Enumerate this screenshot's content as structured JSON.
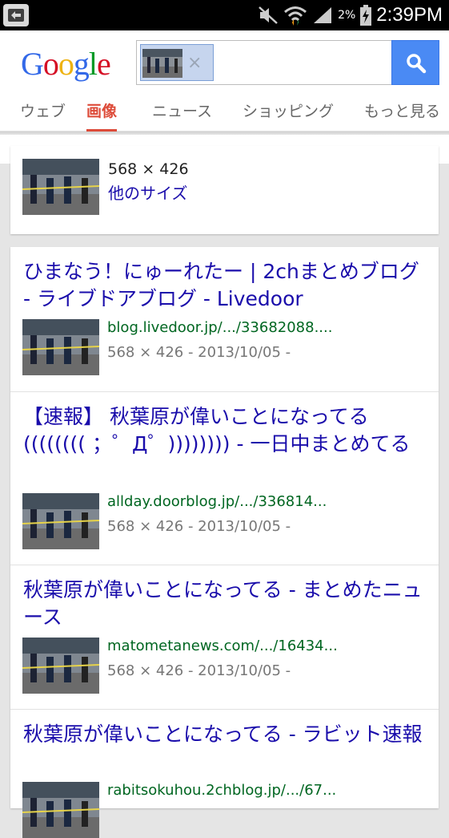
{
  "status_bar": {
    "battery_percent": "2%",
    "time": "2:39PM"
  },
  "header": {
    "logo_letters": [
      "G",
      "o",
      "o",
      "g",
      "l",
      "e"
    ],
    "search_chip_remove": "×"
  },
  "tabs": [
    {
      "label": "ウェブ",
      "active": false
    },
    {
      "label": "画像",
      "active": true
    },
    {
      "label": "ニュース",
      "active": false
    },
    {
      "label": "ショッピング",
      "active": false
    },
    {
      "label": "もっと見る",
      "active": false
    }
  ],
  "size_card": {
    "dimensions": "568 × 426",
    "more_sizes_label": "他のサイズ"
  },
  "results": [
    {
      "title": "ひまなう！にゅーれたー | 2chまとめブログ - ライブドアブログ - Livedoor",
      "url": "blog.livedoor.jp/.../33682088....",
      "meta": "568 × 426 - 2013/10/05 -"
    },
    {
      "title": "【速報】 秋葉原が偉いことになってる((((((((  ；゜Д゜)))))))) - 一日中まとめてる",
      "url": "allday.doorblog.jp/.../336814...",
      "meta": "568 × 426 - 2013/10/05 -"
    },
    {
      "title": "秋葉原が偉いことになってる - まとめたニュース",
      "url": "matometanews.com/.../16434...",
      "meta": "568 × 426 - 2013/10/05 -"
    },
    {
      "title": "秋葉原が偉いことになってる - ラビット速報",
      "url": "rabitsokuhou.2chblog.jp/.../67...",
      "meta": ""
    }
  ],
  "colors": {
    "accent_red": "#dd4b39",
    "link_blue": "#1a0dab",
    "url_green": "#006621",
    "search_button_blue": "#4a8af4"
  }
}
